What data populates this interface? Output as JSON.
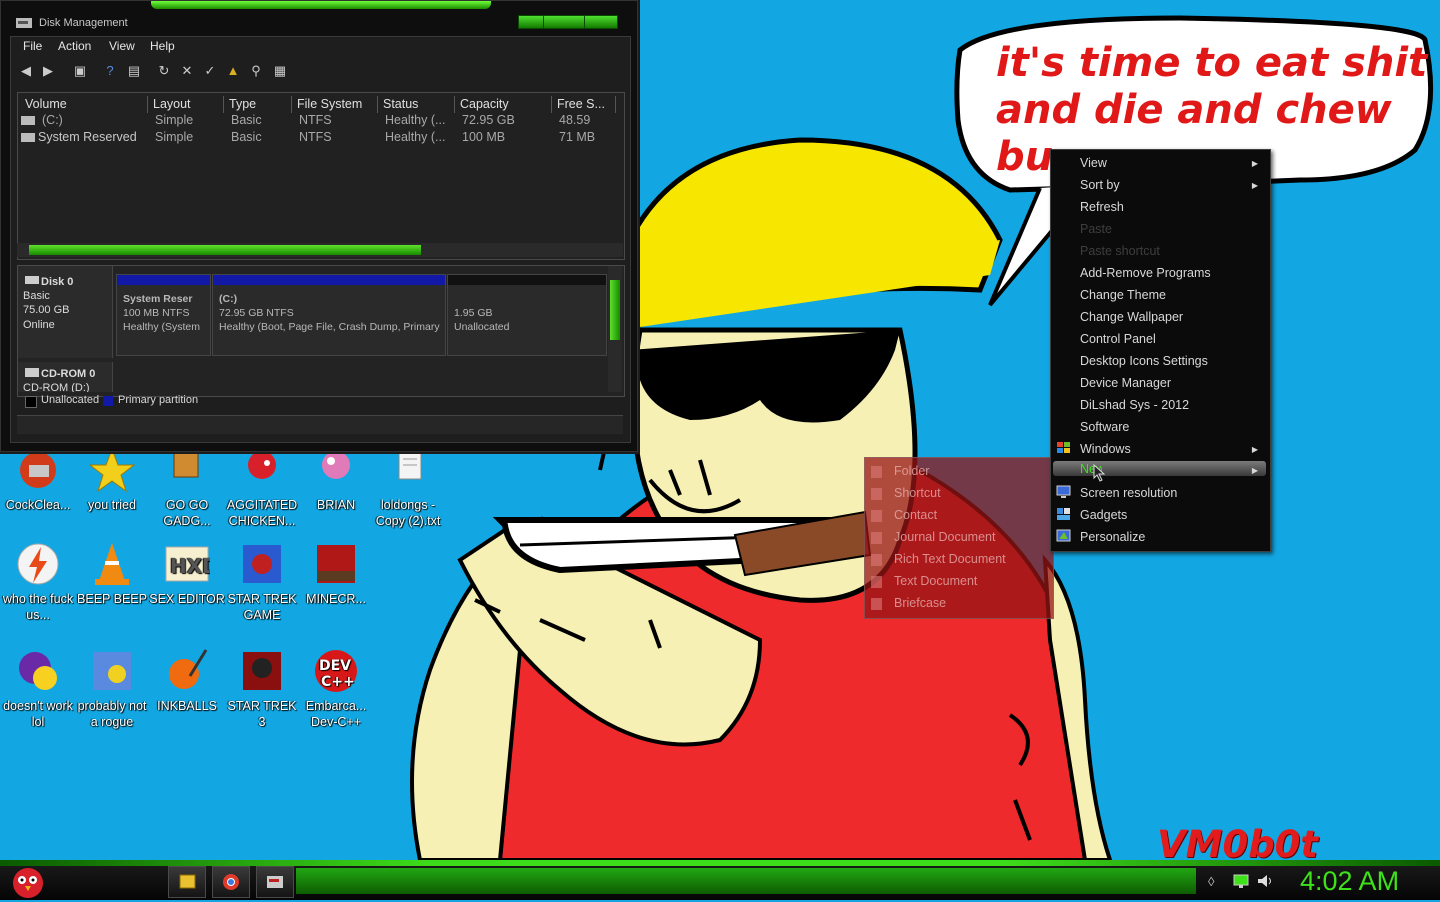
{
  "wallpaper": {
    "bubble_lines": [
      "it's time to eat shit",
      "and die and chew",
      "bu"
    ],
    "watermark": "VM0b0t"
  },
  "window": {
    "title": "Disk Management",
    "menu": [
      "File",
      "Action",
      "View",
      "Help"
    ],
    "columns": [
      "Volume",
      "Layout",
      "Type",
      "File System",
      "Status",
      "Capacity",
      "Free S..."
    ],
    "rows": [
      {
        "volume": "(C:)",
        "layout": "Simple",
        "type": "Basic",
        "fs": "NTFS",
        "status": "Healthy (...",
        "capacity": "72.95 GB",
        "free": "48.59"
      },
      {
        "volume": "System Reserved",
        "layout": "Simple",
        "type": "Basic",
        "fs": "NTFS",
        "status": "Healthy (...",
        "capacity": "100 MB",
        "free": "71 MB"
      }
    ],
    "disk0": {
      "name": "Disk 0",
      "type": "Basic",
      "size": "75.00 GB",
      "state": "Online",
      "partitions": [
        {
          "name": "System Reser",
          "size": "100 MB NTFS",
          "status": "Healthy (System"
        },
        {
          "name": "(C:)",
          "size": "72.95 GB NTFS",
          "status": "Healthy (Boot, Page File, Crash Dump, Primary"
        },
        {
          "name": "",
          "size": "1.95 GB",
          "status": "Unallocated"
        }
      ]
    },
    "cdrom": {
      "name": "CD-ROM 0",
      "sub": "CD-ROM (D:)"
    },
    "legend": [
      "Unallocated",
      "Primary partition"
    ]
  },
  "context_menu": {
    "items": [
      {
        "label": "View",
        "arrow": true,
        "enabled": true
      },
      {
        "label": "Sort by",
        "arrow": true,
        "enabled": true
      },
      {
        "label": "Refresh",
        "arrow": false,
        "enabled": true
      },
      {
        "label": "Paste",
        "arrow": false,
        "enabled": false
      },
      {
        "label": "Paste shortcut",
        "arrow": false,
        "enabled": false
      },
      {
        "label": "Add-Remove Programs",
        "arrow": false,
        "enabled": true
      },
      {
        "label": "Change Theme",
        "arrow": false,
        "enabled": true
      },
      {
        "label": "Change Wallpaper",
        "arrow": false,
        "enabled": true
      },
      {
        "label": "Control Panel",
        "arrow": false,
        "enabled": true
      },
      {
        "label": "Desktop Icons Settings",
        "arrow": false,
        "enabled": true
      },
      {
        "label": "Device Manager",
        "arrow": false,
        "enabled": true
      },
      {
        "label": "DiLshad Sys - 2012",
        "arrow": false,
        "enabled": true
      },
      {
        "label": "Software",
        "arrow": false,
        "enabled": true
      },
      {
        "label": "Windows",
        "arrow": true,
        "enabled": true
      },
      {
        "label": "New",
        "arrow": true,
        "enabled": true
      },
      {
        "label": "Screen resolution",
        "arrow": false,
        "enabled": true
      },
      {
        "label": "Gadgets",
        "arrow": false,
        "enabled": true
      },
      {
        "label": "Personalize",
        "arrow": false,
        "enabled": true
      }
    ]
  },
  "new_submenu": [
    "Folder",
    "Shortcut",
    "Contact",
    "Journal Document",
    "Rich Text Document",
    "Text Document",
    "Briefcase"
  ],
  "desktop_icons": [
    {
      "label": "CockClea..."
    },
    {
      "label": "you tried"
    },
    {
      "label": "GO GO GADG..."
    },
    {
      "label": "AGGITATED CHICKEN..."
    },
    {
      "label": "BRIAN"
    },
    {
      "label": "loldongs - Copy (2).txt"
    },
    {
      "label": "who the fuck us..."
    },
    {
      "label": "BEEP BEEP"
    },
    {
      "label": "SEX EDITOR"
    },
    {
      "label": "STAR TREK GAME"
    },
    {
      "label": "MINECR..."
    },
    {
      "label": "doesn't work lol"
    },
    {
      "label": "probably not a rogue"
    },
    {
      "label": "INKBALLS"
    },
    {
      "label": "STAR TREK 3"
    },
    {
      "label": "Embarca... Dev-C++"
    }
  ],
  "taskbar": {
    "clock": "4:02 AM"
  },
  "colors": {
    "accent": "#3ee21a",
    "wallpaper": "#12a7e2"
  }
}
